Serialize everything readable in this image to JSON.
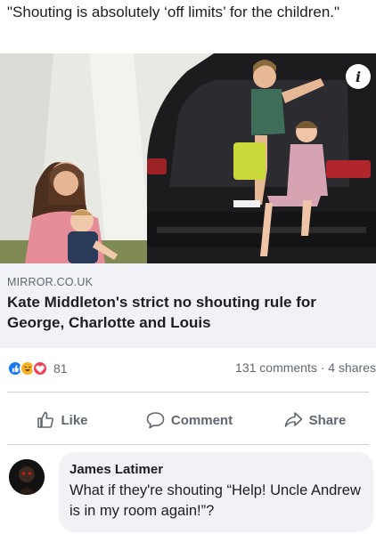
{
  "post": {
    "text": "\"Shouting is absolutely ‘off limits’ for the children.\""
  },
  "link": {
    "domain": "MIRROR.CO.UK",
    "title": "Kate Middleton's strict no shouting rule for George, Charlotte and Louis",
    "info_icon": "info-icon",
    "photo_colors": {
      "tent": "#e9e9e4",
      "car": "#1c1c1f",
      "grass": "#7f8a55"
    }
  },
  "stats": {
    "reaction_icons": [
      "like",
      "haha",
      "love"
    ],
    "reaction_count": "81",
    "comments_shares": "131 comments · 4 shares"
  },
  "actions": {
    "like": "Like",
    "comment": "Comment",
    "share": "Share"
  },
  "comment": {
    "author": "James Latimer",
    "text": "What if they're shouting “Help! Uncle Andrew is in my room again!”?"
  },
  "colors": {
    "like_blue": "#1877f2",
    "haha_yellow": "#f7b125",
    "love_red": "#f33e58",
    "muted_text": "#606770",
    "bubble_bg": "#f0f2f5"
  }
}
